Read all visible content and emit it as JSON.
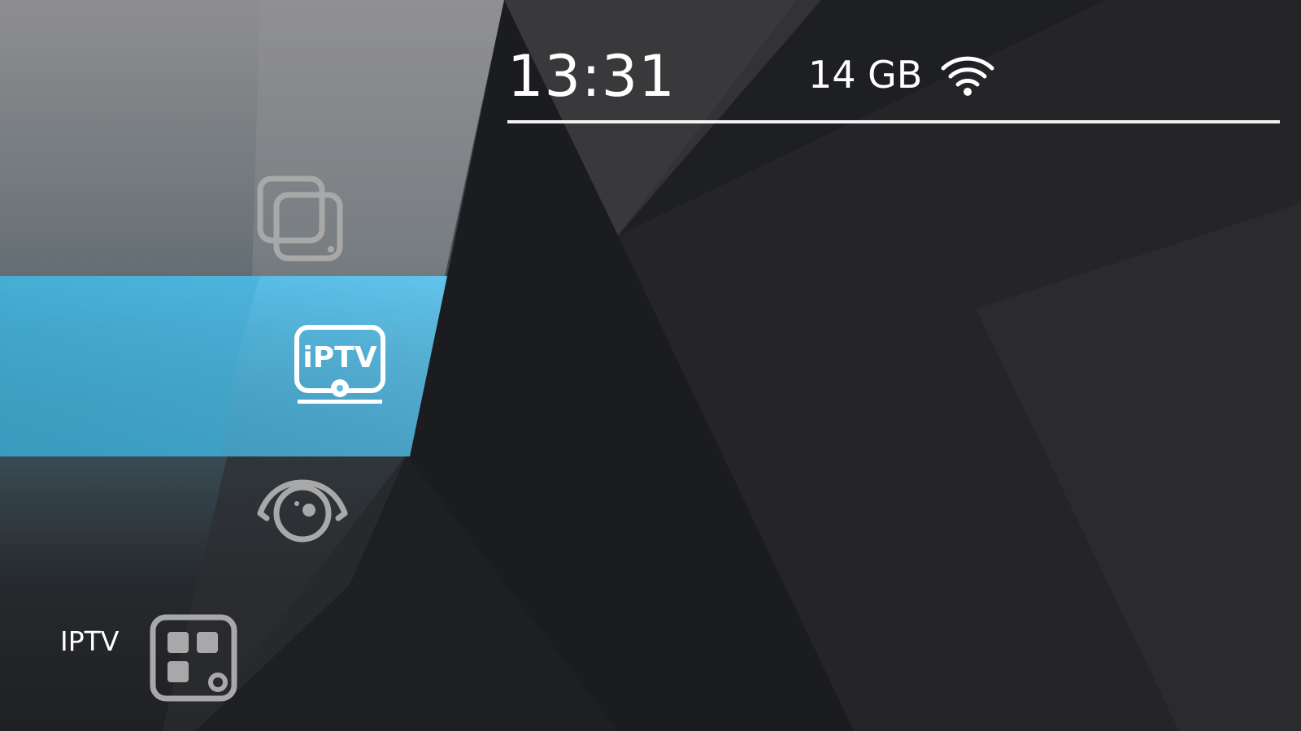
{
  "status_bar": {
    "time": "13:31",
    "storage": "14 GB",
    "wifi_icon": "wifi-icon"
  },
  "menu": {
    "items": [
      {
        "id": "gallery",
        "icon": "stacked-screens-icon",
        "selected": false
      },
      {
        "id": "iptv",
        "label": "IPTV",
        "icon": "iptv-tv-icon",
        "icon_text": "iPTV",
        "selected": true
      },
      {
        "id": "camera",
        "icon": "eye-camera-icon",
        "selected": false
      },
      {
        "id": "apps",
        "icon": "apps-grid-icon",
        "selected": false
      }
    ]
  },
  "colors": {
    "accent": "#5bbde6",
    "background": "#1f2023",
    "icon_gray": "#a6a6a6",
    "text": "#ffffff"
  }
}
